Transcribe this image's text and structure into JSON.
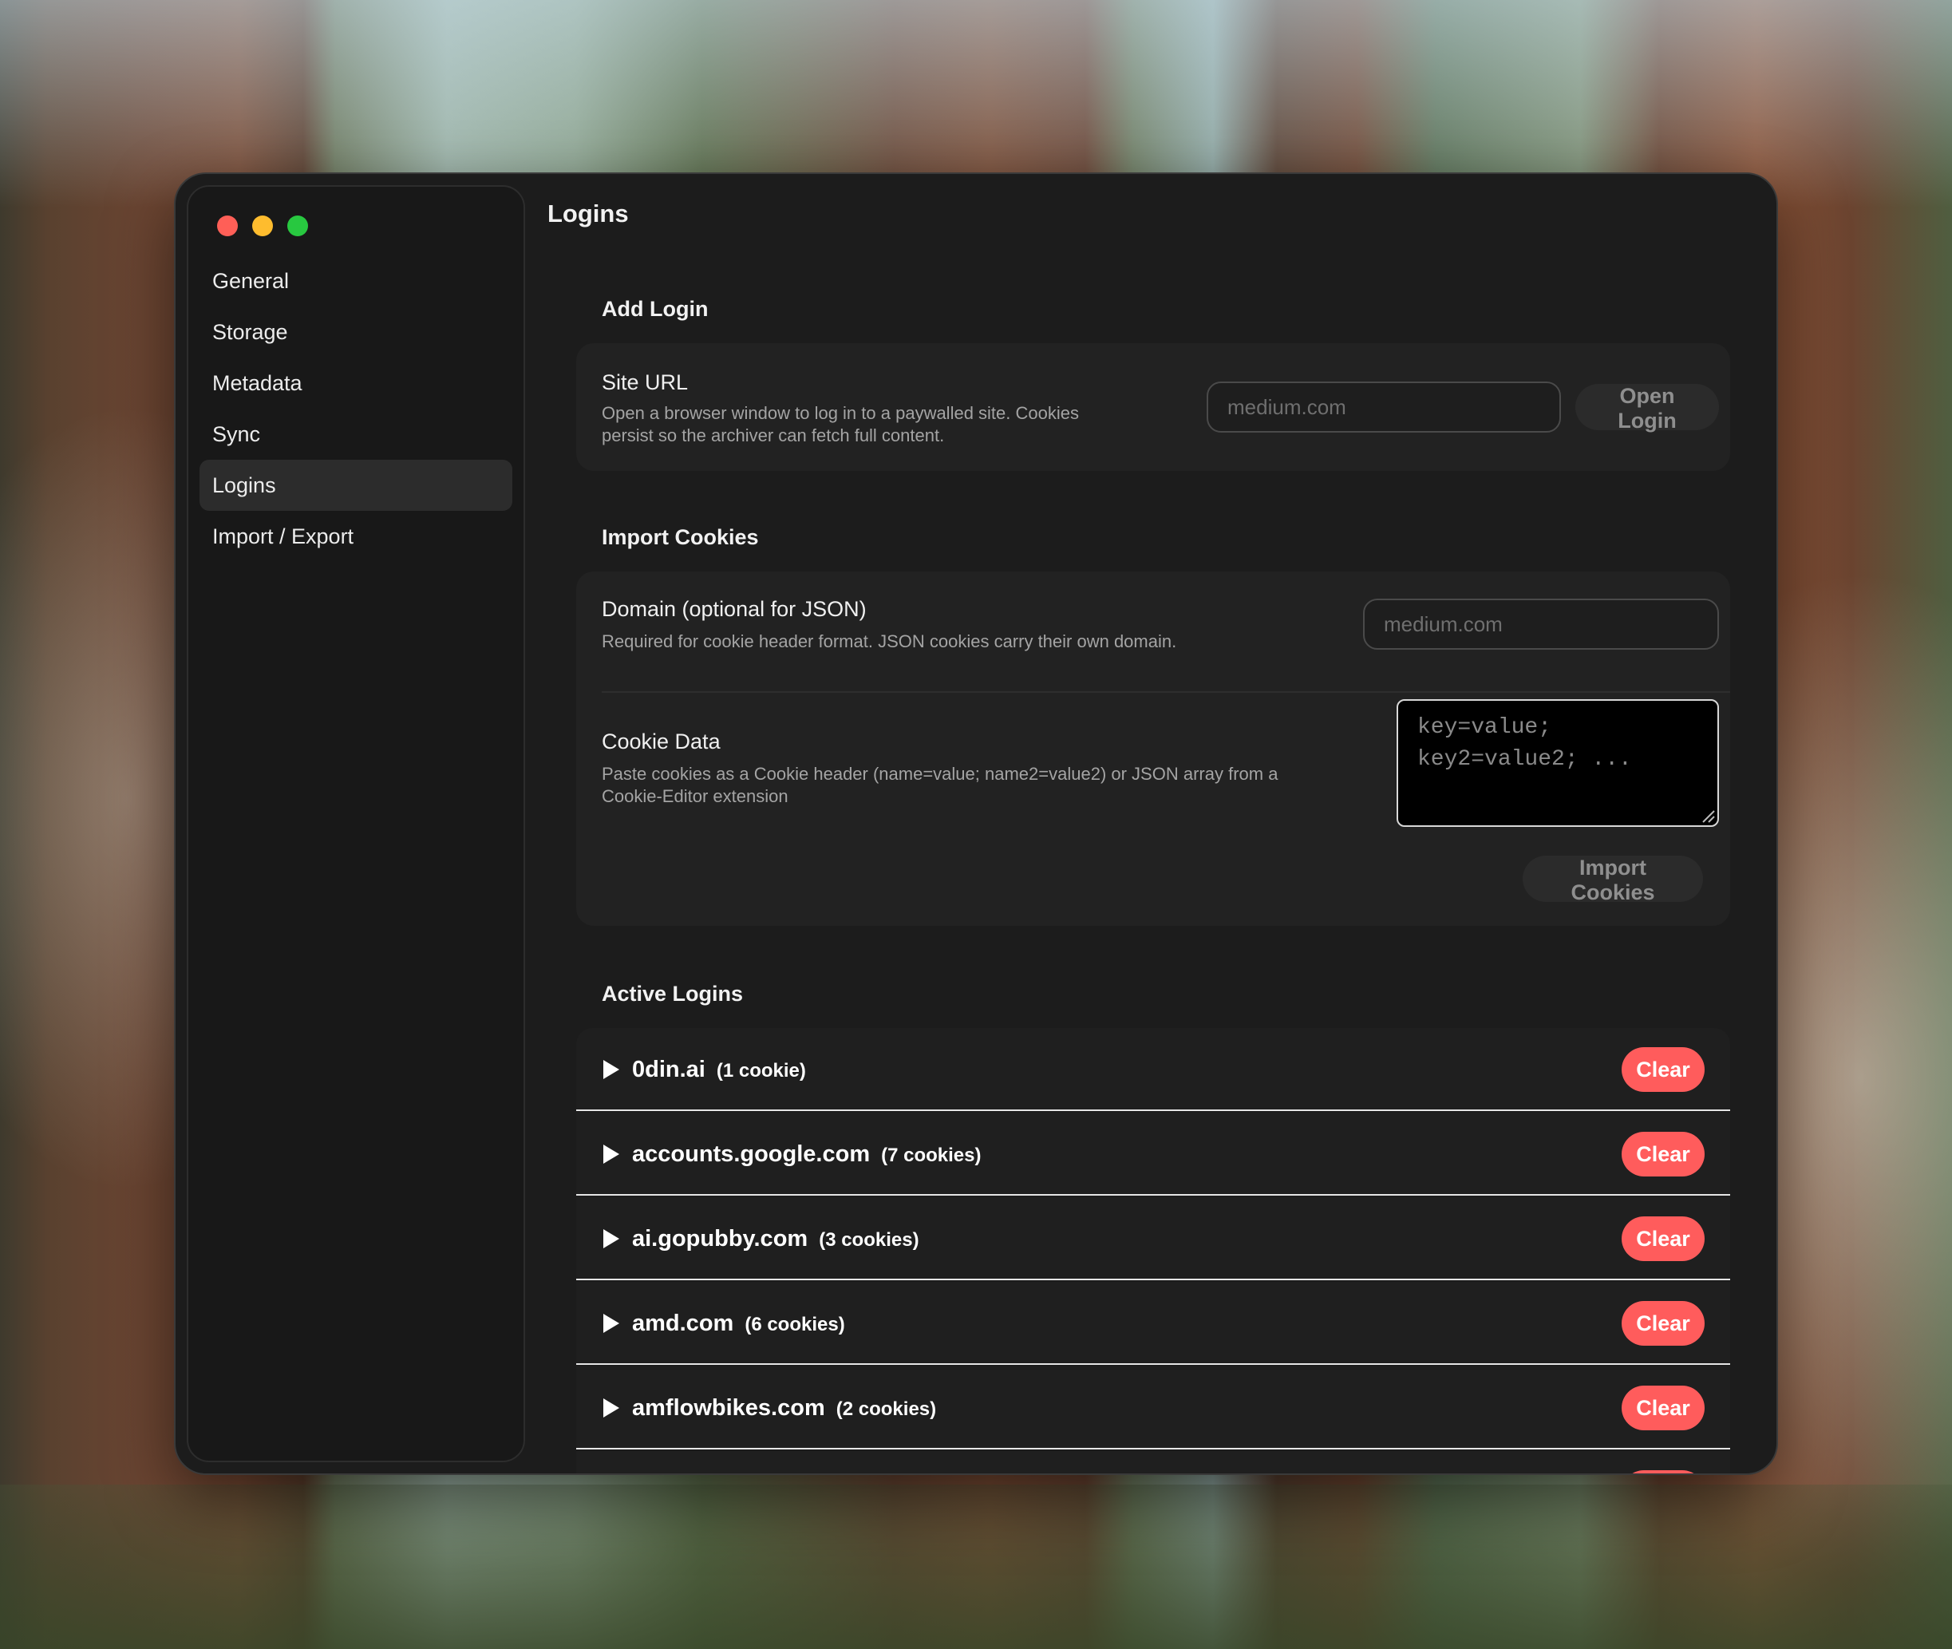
{
  "window": {
    "title": "Logins"
  },
  "sidebar": {
    "items": [
      {
        "label": "General"
      },
      {
        "label": "Storage"
      },
      {
        "label": "Metadata"
      },
      {
        "label": "Sync"
      },
      {
        "label": "Logins",
        "active": true
      },
      {
        "label": "Import / Export"
      }
    ]
  },
  "add_login": {
    "section_title": "Add Login",
    "site_url_title": "Site URL",
    "site_url_desc_1": "Open a browser window to log in to a paywalled site. Cookies",
    "site_url_desc_2": "persist so the archiver can fetch full content.",
    "url_placeholder": "medium.com",
    "open_login_label": "Open Login"
  },
  "import_cookies": {
    "section_title": "Import Cookies",
    "domain_title": "Domain (optional for JSON)",
    "domain_desc": "Required for cookie header format. JSON cookies carry their own domain.",
    "domain_placeholder": "medium.com",
    "cookie_data_title": "Cookie Data",
    "cookie_data_desc_1": "Paste cookies as a Cookie header (name=value; name2=value2) or JSON array from a",
    "cookie_data_desc_2": "Cookie-Editor extension",
    "cookie_data_placeholder": "key=value;\nkey2=value2; ...",
    "import_button_label": "Import Cookies"
  },
  "active_logins": {
    "section_title": "Active Logins",
    "clear_label": "Clear",
    "rows": [
      {
        "domain": "0din.ai",
        "count": "(1 cookie)"
      },
      {
        "domain": "accounts.google.com",
        "count": "(7 cookies)"
      },
      {
        "domain": "ai.gopubby.com",
        "count": "(3 cookies)"
      },
      {
        "domain": "amd.com",
        "count": "(6 cookies)"
      },
      {
        "domain": "amflowbikes.com",
        "count": "(2 cookies)"
      }
    ]
  },
  "colors": {
    "window_bg": "#1c1c1c",
    "card_bg": "#222222",
    "clear_button": "#ff5c5c",
    "traffic_red": "#ff5f57",
    "traffic_yellow": "#febc2e",
    "traffic_green": "#28c840"
  },
  "icons": [
    "disclosure-triangle-icon",
    "resize-grip-icon"
  ]
}
